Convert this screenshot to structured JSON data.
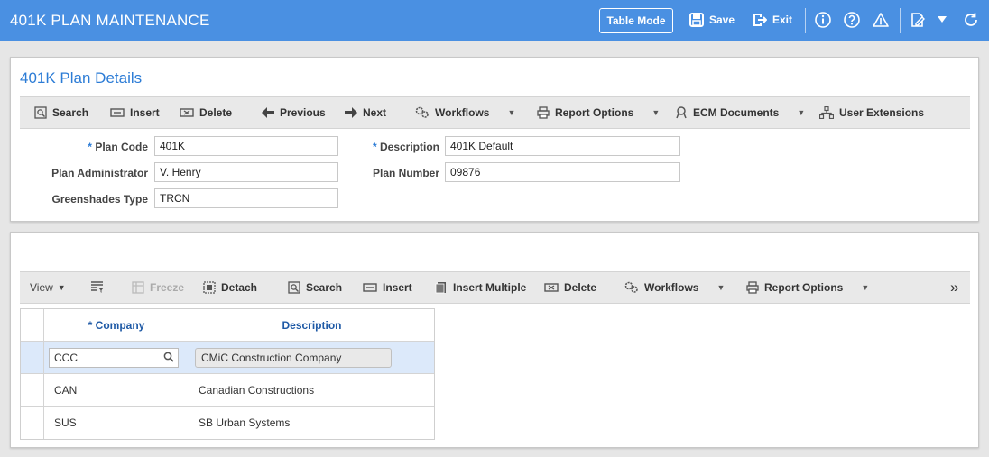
{
  "app": {
    "title": "401K PLAN MAINTENANCE",
    "table_mode": "Table Mode",
    "save": "Save",
    "exit": "Exit"
  },
  "details": {
    "title": "401K Plan Details",
    "toolbar": {
      "search": "Search",
      "insert": "Insert",
      "delete": "Delete",
      "previous": "Previous",
      "next": "Next",
      "workflows": "Workflows",
      "report_options": "Report Options",
      "ecm_documents": "ECM Documents",
      "user_extensions": "User Extensions"
    },
    "form": {
      "plan_code_label": "Plan Code",
      "plan_code": "401K",
      "plan_admin_label": "Plan Administrator",
      "plan_admin": "V. Henry",
      "greenshades_label": "Greenshades Type",
      "greenshades": "TRCN",
      "description_label": "Description",
      "description": "401K Default",
      "plan_number_label": "Plan Number",
      "plan_number": "09876",
      "required_mark": "*"
    }
  },
  "company_grid": {
    "toolbar": {
      "view": "View",
      "freeze": "Freeze",
      "detach": "Detach",
      "search": "Search",
      "insert": "Insert",
      "insert_multiple": "Insert Multiple",
      "delete": "Delete",
      "workflows": "Workflows",
      "report_options": "Report Options",
      "more": "»"
    },
    "columns": [
      "* Company",
      "Description"
    ],
    "rows": [
      {
        "company": "CCC",
        "description": "CMiC Construction Company"
      },
      {
        "company": "CAN",
        "description": "Canadian Constructions"
      },
      {
        "company": "SUS",
        "description": "SB Urban Systems"
      }
    ]
  },
  "colors": {
    "header_blue": "#4a90e2",
    "title_blue": "#2c7cd6",
    "selected_row": "#dce9fa"
  }
}
